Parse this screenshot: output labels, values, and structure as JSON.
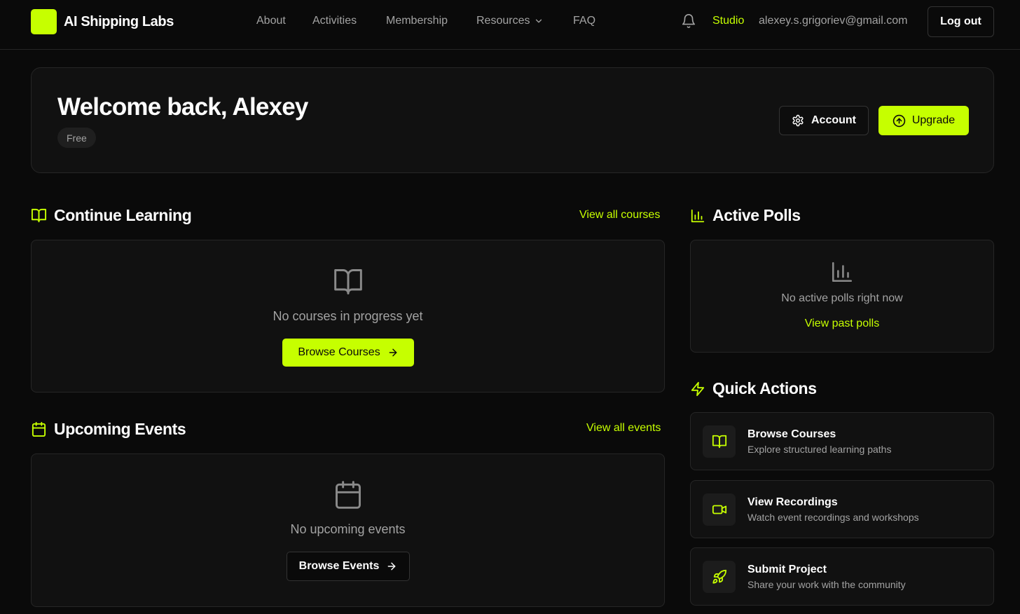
{
  "header": {
    "brand": "AI Shipping Labs",
    "nav": [
      "About",
      "Activities",
      "Membership",
      "Resources",
      "FAQ"
    ],
    "studio": "Studio",
    "email": "alexey.s.grigoriev@gmail.com",
    "logout": "Log out"
  },
  "welcome": {
    "title": "Welcome back, Alexey",
    "plan": "Free",
    "account_button": "Account",
    "upgrade_button": "Upgrade"
  },
  "learning": {
    "title": "Continue Learning",
    "link": "View all courses",
    "empty_text": "No courses in progress yet",
    "button": "Browse Courses"
  },
  "events": {
    "title": "Upcoming Events",
    "link": "View all events",
    "empty_text": "No upcoming events",
    "button": "Browse Events"
  },
  "polls": {
    "title": "Active Polls",
    "empty_text": "No active polls right now",
    "link": "View past polls"
  },
  "quick_actions": {
    "title": "Quick Actions",
    "items": [
      {
        "title": "Browse Courses",
        "subtitle": "Explore structured learning paths",
        "icon": "book-open-icon"
      },
      {
        "title": "View Recordings",
        "subtitle": "Watch event recordings and workshops",
        "icon": "video-icon"
      },
      {
        "title": "Submit Project",
        "subtitle": "Share your work with the community",
        "icon": "rocket-icon"
      }
    ]
  },
  "colors": {
    "accent": "#c6ff00",
    "background": "#0a0a0a",
    "card": "#111111"
  }
}
